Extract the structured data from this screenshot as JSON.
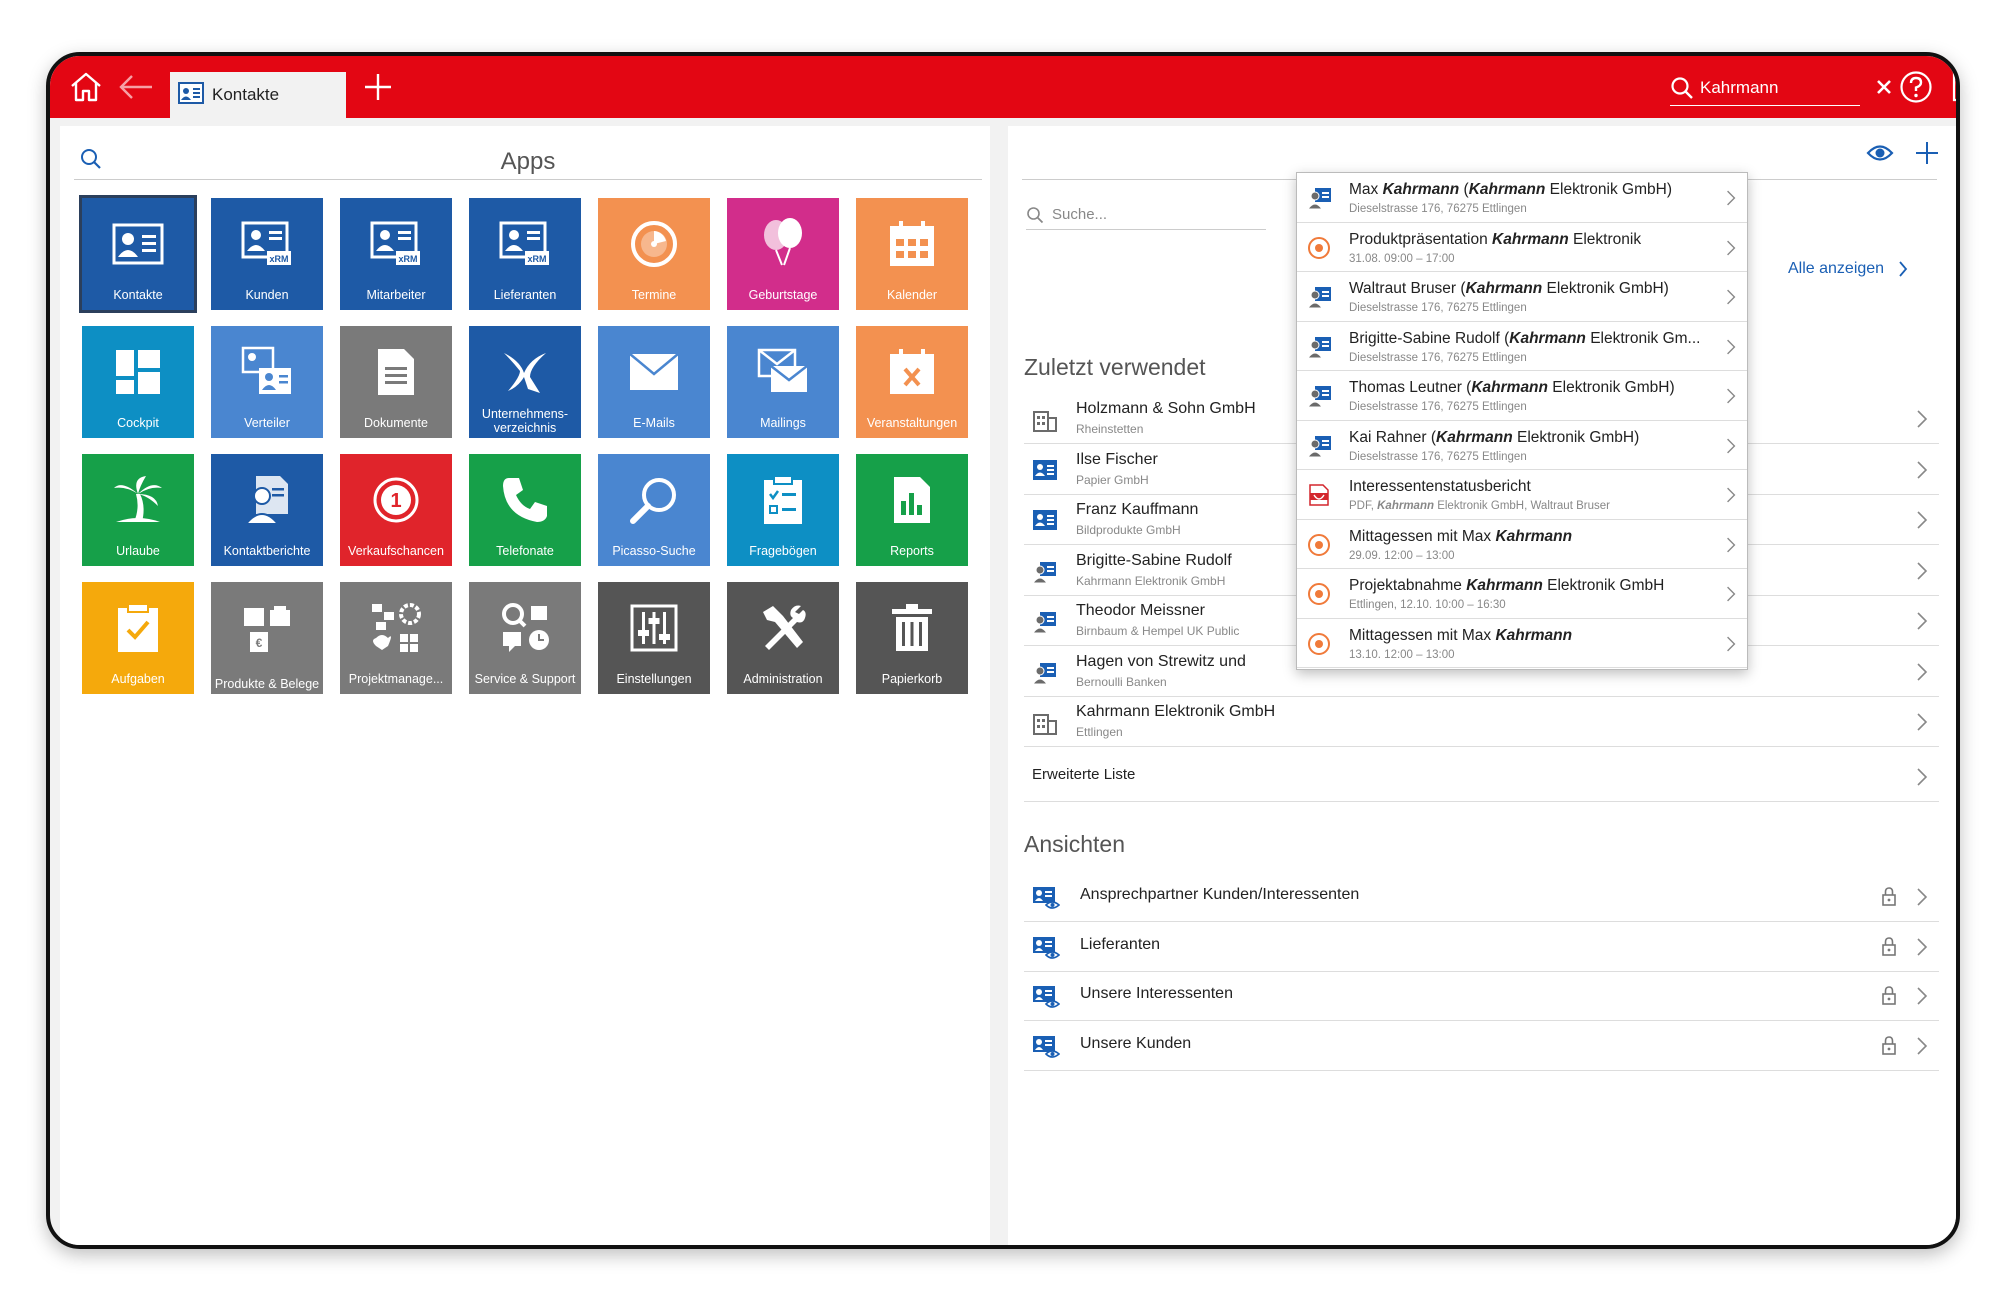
{
  "app": {
    "tab_label": "Kontakte",
    "search_value": "Kahrmann"
  },
  "apps": {
    "title": "Apps",
    "tiles": [
      {
        "label": "Kontakte",
        "color": "#1e5aa6",
        "icon": "contact-card-icon"
      },
      {
        "label": "Kunden",
        "color": "#1e5aa6",
        "icon": "xrm-card-icon"
      },
      {
        "label": "Mitarbeiter",
        "color": "#1e5aa6",
        "icon": "xrm-card-icon"
      },
      {
        "label": "Lieferanten",
        "color": "#1e5aa6",
        "icon": "xrm-card-icon"
      },
      {
        "label": "Termine",
        "color": "#f39150",
        "icon": "appointment-icon"
      },
      {
        "label": "Geburtstage",
        "color": "#d22d8b",
        "icon": "balloons-icon"
      },
      {
        "label": "Kalender",
        "color": "#f39150",
        "icon": "calendar-icon"
      },
      {
        "label": "Cockpit",
        "color": "#0d8fc4",
        "icon": "cockpit-icon"
      },
      {
        "label": "Verteiler",
        "color": "#4a86d0",
        "icon": "distribution-icon"
      },
      {
        "label": "Dokumente",
        "color": "#7a7a7a",
        "icon": "document-icon"
      },
      {
        "label": "Unternehmens-verzeichnis",
        "color": "#1e5aa6",
        "icon": "directory-icon"
      },
      {
        "label": "E-Mails",
        "color": "#4a86d0",
        "icon": "mail-icon"
      },
      {
        "label": "Mailings",
        "color": "#4a86d0",
        "icon": "mailing-icon"
      },
      {
        "label": "Veranstaltungen",
        "color": "#f39150",
        "icon": "event-icon"
      },
      {
        "label": "Urlaube",
        "color": "#16a049",
        "icon": "palm-icon"
      },
      {
        "label": "Kontaktberichte",
        "color": "#1e5aa6",
        "icon": "report-person-icon"
      },
      {
        "label": "Verkaufschancen",
        "color": "#e0242b",
        "icon": "sales-chance-icon"
      },
      {
        "label": "Telefonate",
        "color": "#16a049",
        "icon": "phone-icon"
      },
      {
        "label": "Picasso-Suche",
        "color": "#4a86d0",
        "icon": "magnifier-icon"
      },
      {
        "label": "Fragebögen",
        "color": "#0d8fc4",
        "icon": "questionnaire-icon"
      },
      {
        "label": "Reports",
        "color": "#16a049",
        "icon": "reports-icon"
      },
      {
        "label": "Aufgaben",
        "color": "#f5a90c",
        "icon": "task-icon"
      },
      {
        "label": "Produkte & Belege",
        "color": "#7a7a7a",
        "icon": "products-icon"
      },
      {
        "label": "Projektmanage...",
        "color": "#7a7a7a",
        "icon": "project-icon"
      },
      {
        "label": "Service & Support",
        "color": "#7a7a7a",
        "icon": "service-icon"
      },
      {
        "label": "Einstellungen",
        "color": "#555555",
        "icon": "settings-sliders-icon"
      },
      {
        "label": "Administration",
        "color": "#555555",
        "icon": "tools-icon"
      },
      {
        "label": "Papierkorb",
        "color": "#555555",
        "icon": "trash-icon"
      }
    ]
  },
  "right": {
    "search_placeholder": "Suche...",
    "show_all": "Alle anzeigen",
    "recent_title": "Zuletzt verwendet",
    "recent": [
      {
        "title": "Holzmann & Sohn GmbH",
        "sub": "Rheinstetten",
        "type": "company"
      },
      {
        "title": "Ilse Fischer",
        "sub": "Papier GmbH",
        "type": "card"
      },
      {
        "title": "Franz Kauffmann",
        "sub": "Bildprodukte GmbH",
        "type": "card"
      },
      {
        "title": "Brigitte-Sabine Rudolf",
        "sub": "Kahrmann Elektronik GmbH",
        "type": "person"
      },
      {
        "title": "Theodor Meissner",
        "sub": "Birnbaum & Hempel UK Public",
        "type": "person"
      },
      {
        "title": "Hagen von Strewitz und",
        "sub": "Bernoulli Banken",
        "type": "person"
      },
      {
        "title": "Kahrmann Elektronik GmbH",
        "sub": "Ettlingen",
        "type": "company"
      }
    ],
    "extended_list": "Erweiterte Liste",
    "views_title": "Ansichten",
    "views": [
      {
        "title": "Ansprechpartner Kunden/Interessenten"
      },
      {
        "title": "Lieferanten"
      },
      {
        "title": "Unsere Interessenten"
      },
      {
        "title": "Unsere Kunden"
      }
    ]
  },
  "dropdown": [
    {
      "pre": "Max ",
      "bold": "Kahrmann",
      "mid": " (",
      "bold2": "Kahrmann",
      "post": " Elektronik GmbH)",
      "sub_pre": "",
      "sub_bold": "",
      "sub": "Dieselstrasse 176, 76275 Ettlingen",
      "type": "person"
    },
    {
      "pre": "Produktpräsentation ",
      "bold": "Kahrmann",
      "mid": " Elektronik",
      "bold2": "",
      "post": "",
      "sub_pre": "",
      "sub_bold": "",
      "sub": "31.08. 09:00 – 17:00",
      "type": "appointment"
    },
    {
      "pre": "Waltraut Bruser (",
      "bold": "Kahrmann",
      "mid": " Elektronik GmbH)",
      "bold2": "",
      "post": "",
      "sub_pre": "",
      "sub_bold": "",
      "sub": "Dieselstrasse 176, 76275 Ettlingen",
      "type": "person"
    },
    {
      "pre": "Brigitte-Sabine Rudolf (",
      "bold": "Kahrmann",
      "mid": " Elektronik Gm...",
      "bold2": "",
      "post": "",
      "sub_pre": "",
      "sub_bold": "",
      "sub": "Dieselstrasse 176, 76275 Ettlingen",
      "type": "person"
    },
    {
      "pre": "Thomas Leutner (",
      "bold": "Kahrmann",
      "mid": " Elektronik GmbH)",
      "bold2": "",
      "post": "",
      "sub_pre": "",
      "sub_bold": "",
      "sub": "Dieselstrasse 176, 76275 Ettlingen",
      "type": "person"
    },
    {
      "pre": "Kai Rahner (",
      "bold": "Kahrmann",
      "mid": " Elektronik GmbH)",
      "bold2": "",
      "post": "",
      "sub_pre": "",
      "sub_bold": "",
      "sub": "Dieselstrasse 176, 76275 Ettlingen",
      "type": "person"
    },
    {
      "pre": "Interessentenstatusbericht",
      "bold": "",
      "mid": "",
      "bold2": "",
      "post": "",
      "sub_pre": "PDF, ",
      "sub_bold": "Kahrmann",
      "sub": " Elektronik GmbH, Waltraut Bruser",
      "type": "pdf"
    },
    {
      "pre": "Mittagessen mit Max ",
      "bold": "Kahrmann",
      "mid": "",
      "bold2": "",
      "post": "",
      "sub_pre": "",
      "sub_bold": "",
      "sub": "29.09. 12:00 – 13:00",
      "type": "appointment"
    },
    {
      "pre": "Projektabnahme ",
      "bold": "Kahrmann",
      "mid": " Elektronik GmbH",
      "bold2": "",
      "post": "",
      "sub_pre": "",
      "sub_bold": "",
      "sub": "Ettlingen, 12.10. 10:00 – 16:30",
      "type": "appointment"
    },
    {
      "pre": "Mittagessen mit Max ",
      "bold": "Kahrmann",
      "mid": "",
      "bold2": "",
      "post": "",
      "sub_pre": "",
      "sub_bold": "",
      "sub": "13.10. 12:00 – 13:00",
      "type": "appointment"
    }
  ],
  "colors": {
    "brand_red": "#e30613",
    "link_blue": "#1a5fb4"
  }
}
